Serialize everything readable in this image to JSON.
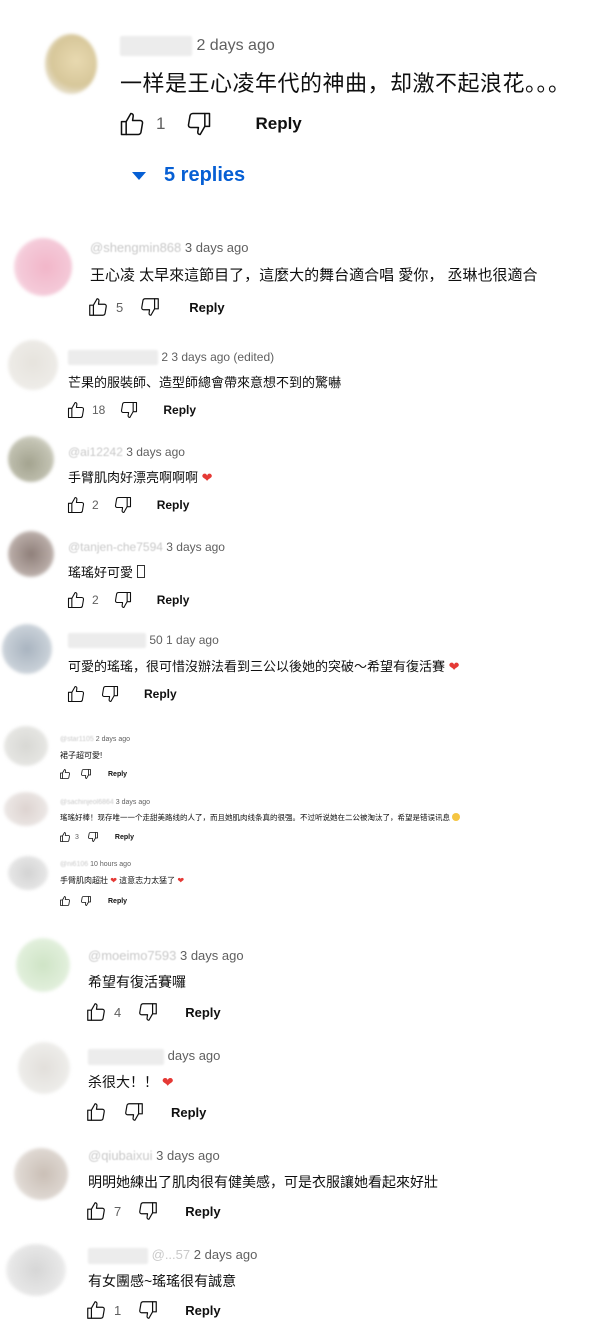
{
  "icons": {
    "like": "thumb-up-icon",
    "dislike": "thumb-down-icon",
    "heart": "heart-icon",
    "expand": "caret-down-icon"
  },
  "colors": {
    "link": "#065fd4",
    "heart": "#e53935",
    "meta": "#606060"
  },
  "reply_label": "Reply",
  "heart_glyph": "❤",
  "comments": [
    {
      "handle": "",
      "time": "2 days ago",
      "text": "一样是王心凌年代的神曲，却激不起浪花。。。",
      "likes": "1",
      "replies_toggle": "5 replies"
    },
    {
      "handle": "@shengmin868",
      "time": "3 days ago",
      "text": "王心凌 太早來這節目了，這麼大的舞台適合唱 愛你， 丞琳也很適合",
      "likes": "5"
    },
    {
      "handle": "2",
      "time": "3 days ago (edited)",
      "text": "芒果的服裝師、造型師總會帶來意想不到的驚嚇",
      "likes": "18"
    },
    {
      "handle": "@ai12242",
      "time": "3 days ago",
      "text": "手臂肌肉好漂亮啊啊啊",
      "likes": "2"
    },
    {
      "handle": "@tanjen-che7594",
      "time": "3 days ago",
      "text": "瑤瑤好可愛",
      "likes": "2"
    },
    {
      "handle": "50",
      "time": "1 day ago",
      "text": "可愛的瑤瑤，很可惜沒辦法看到三公以後她的突破～希望有復活賽",
      "likes": ""
    },
    {
      "handle": "@star1105",
      "time": "2 days ago",
      "text": "裙子超可愛!",
      "likes": ""
    },
    {
      "handle": "@sachinjeol6864",
      "time": "3 days ago",
      "text": "瑤瑤好棒！现存唯一一个走甜美路线的人了，而且她肌肉线条真的很强。不过听说她在二公被淘汰了，希望是错误讯息",
      "likes": "3"
    },
    {
      "handle": "@ni6106",
      "time": "10 hours ago",
      "text": "手臂肌肉超壯",
      "text2": "這意志力太猛了",
      "likes": ""
    },
    {
      "handle": "@moeimo7593",
      "time": "3 days ago",
      "text": "希望有復活賽囉",
      "likes": "4"
    },
    {
      "handle": "",
      "time": "days ago",
      "text": "杀很大！！",
      "likes": ""
    },
    {
      "handle": "@qiubaixui",
      "time": "3 days ago",
      "text": "明明她練出了肌肉很有健美感，可是衣服讓她看起來好壯",
      "likes": "7"
    },
    {
      "handle": "@...57",
      "time": "2 days ago",
      "text": "有女團感~瑤瑤很有誠意",
      "likes": "1"
    }
  ]
}
